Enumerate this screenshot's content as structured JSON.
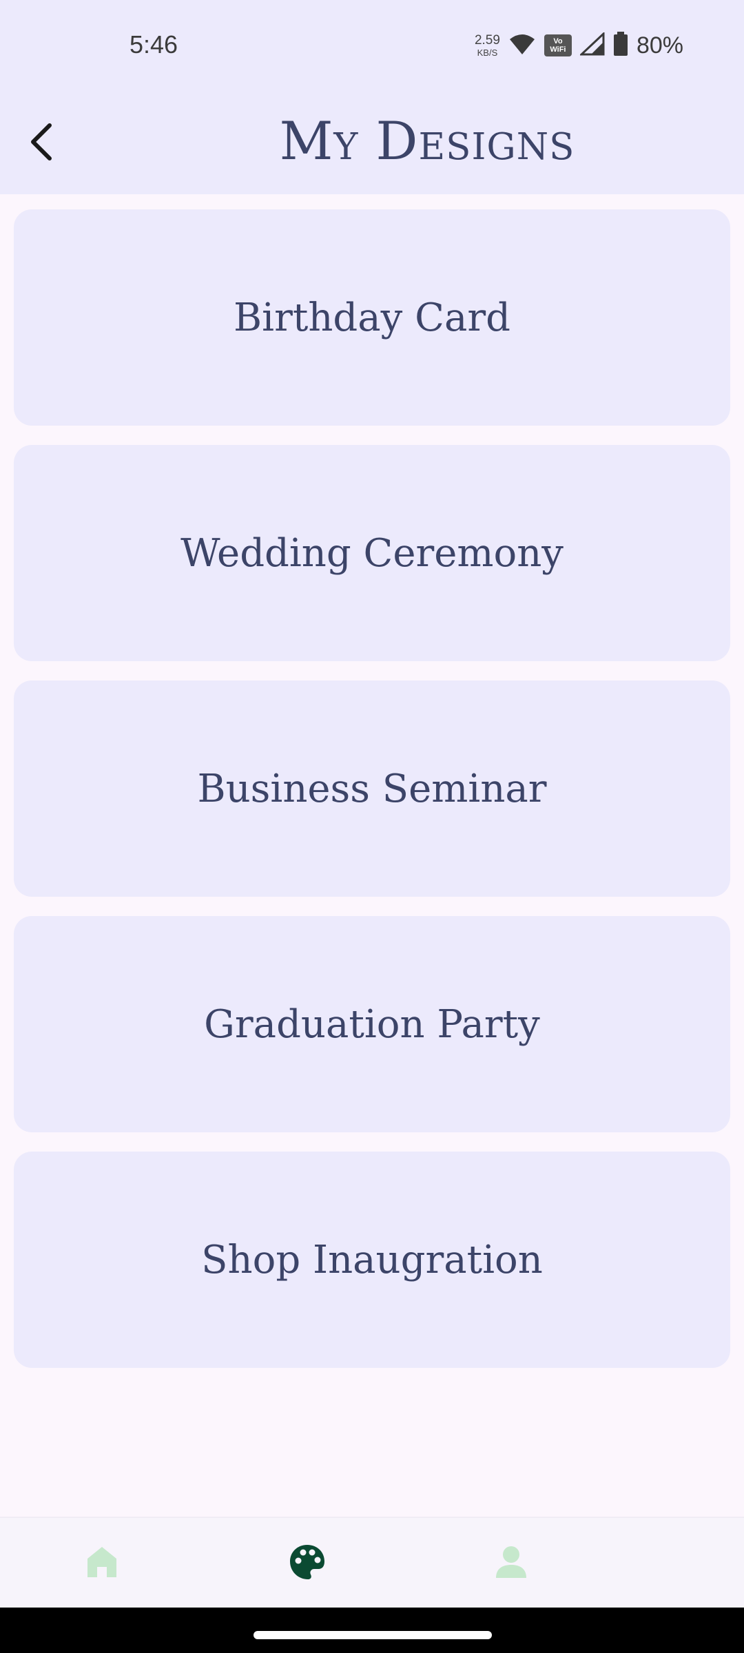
{
  "status_bar": {
    "time": "5:46",
    "net_speed_value": "2.59",
    "net_speed_unit": "KB/S",
    "vowifi_top": "Vo",
    "vowifi_bottom": "WiFi",
    "battery_percent": "80%",
    "icons": [
      "wifi-icon",
      "vowifi-icon",
      "cell-signal-icon",
      "battery-icon"
    ]
  },
  "header": {
    "title": "My Designs",
    "back_icon": "chevron-left-icon"
  },
  "designs": [
    {
      "label": "Birthday Card"
    },
    {
      "label": "Wedding Ceremony"
    },
    {
      "label": "Business Seminar"
    },
    {
      "label": "Graduation Party"
    },
    {
      "label": "Shop Inaugration"
    }
  ],
  "bottom_nav": {
    "items": [
      {
        "icon": "home-icon",
        "active": false
      },
      {
        "icon": "palette-icon",
        "active": true
      },
      {
        "icon": "person-icon",
        "active": false
      }
    ],
    "active_color": "#0b4a32",
    "inactive_color": "#c6e8cc"
  },
  "colors": {
    "header_bg": "#eceafc",
    "card_bg": "#eceafc",
    "page_bg": "#fcf6fd",
    "text": "#3c4468"
  }
}
